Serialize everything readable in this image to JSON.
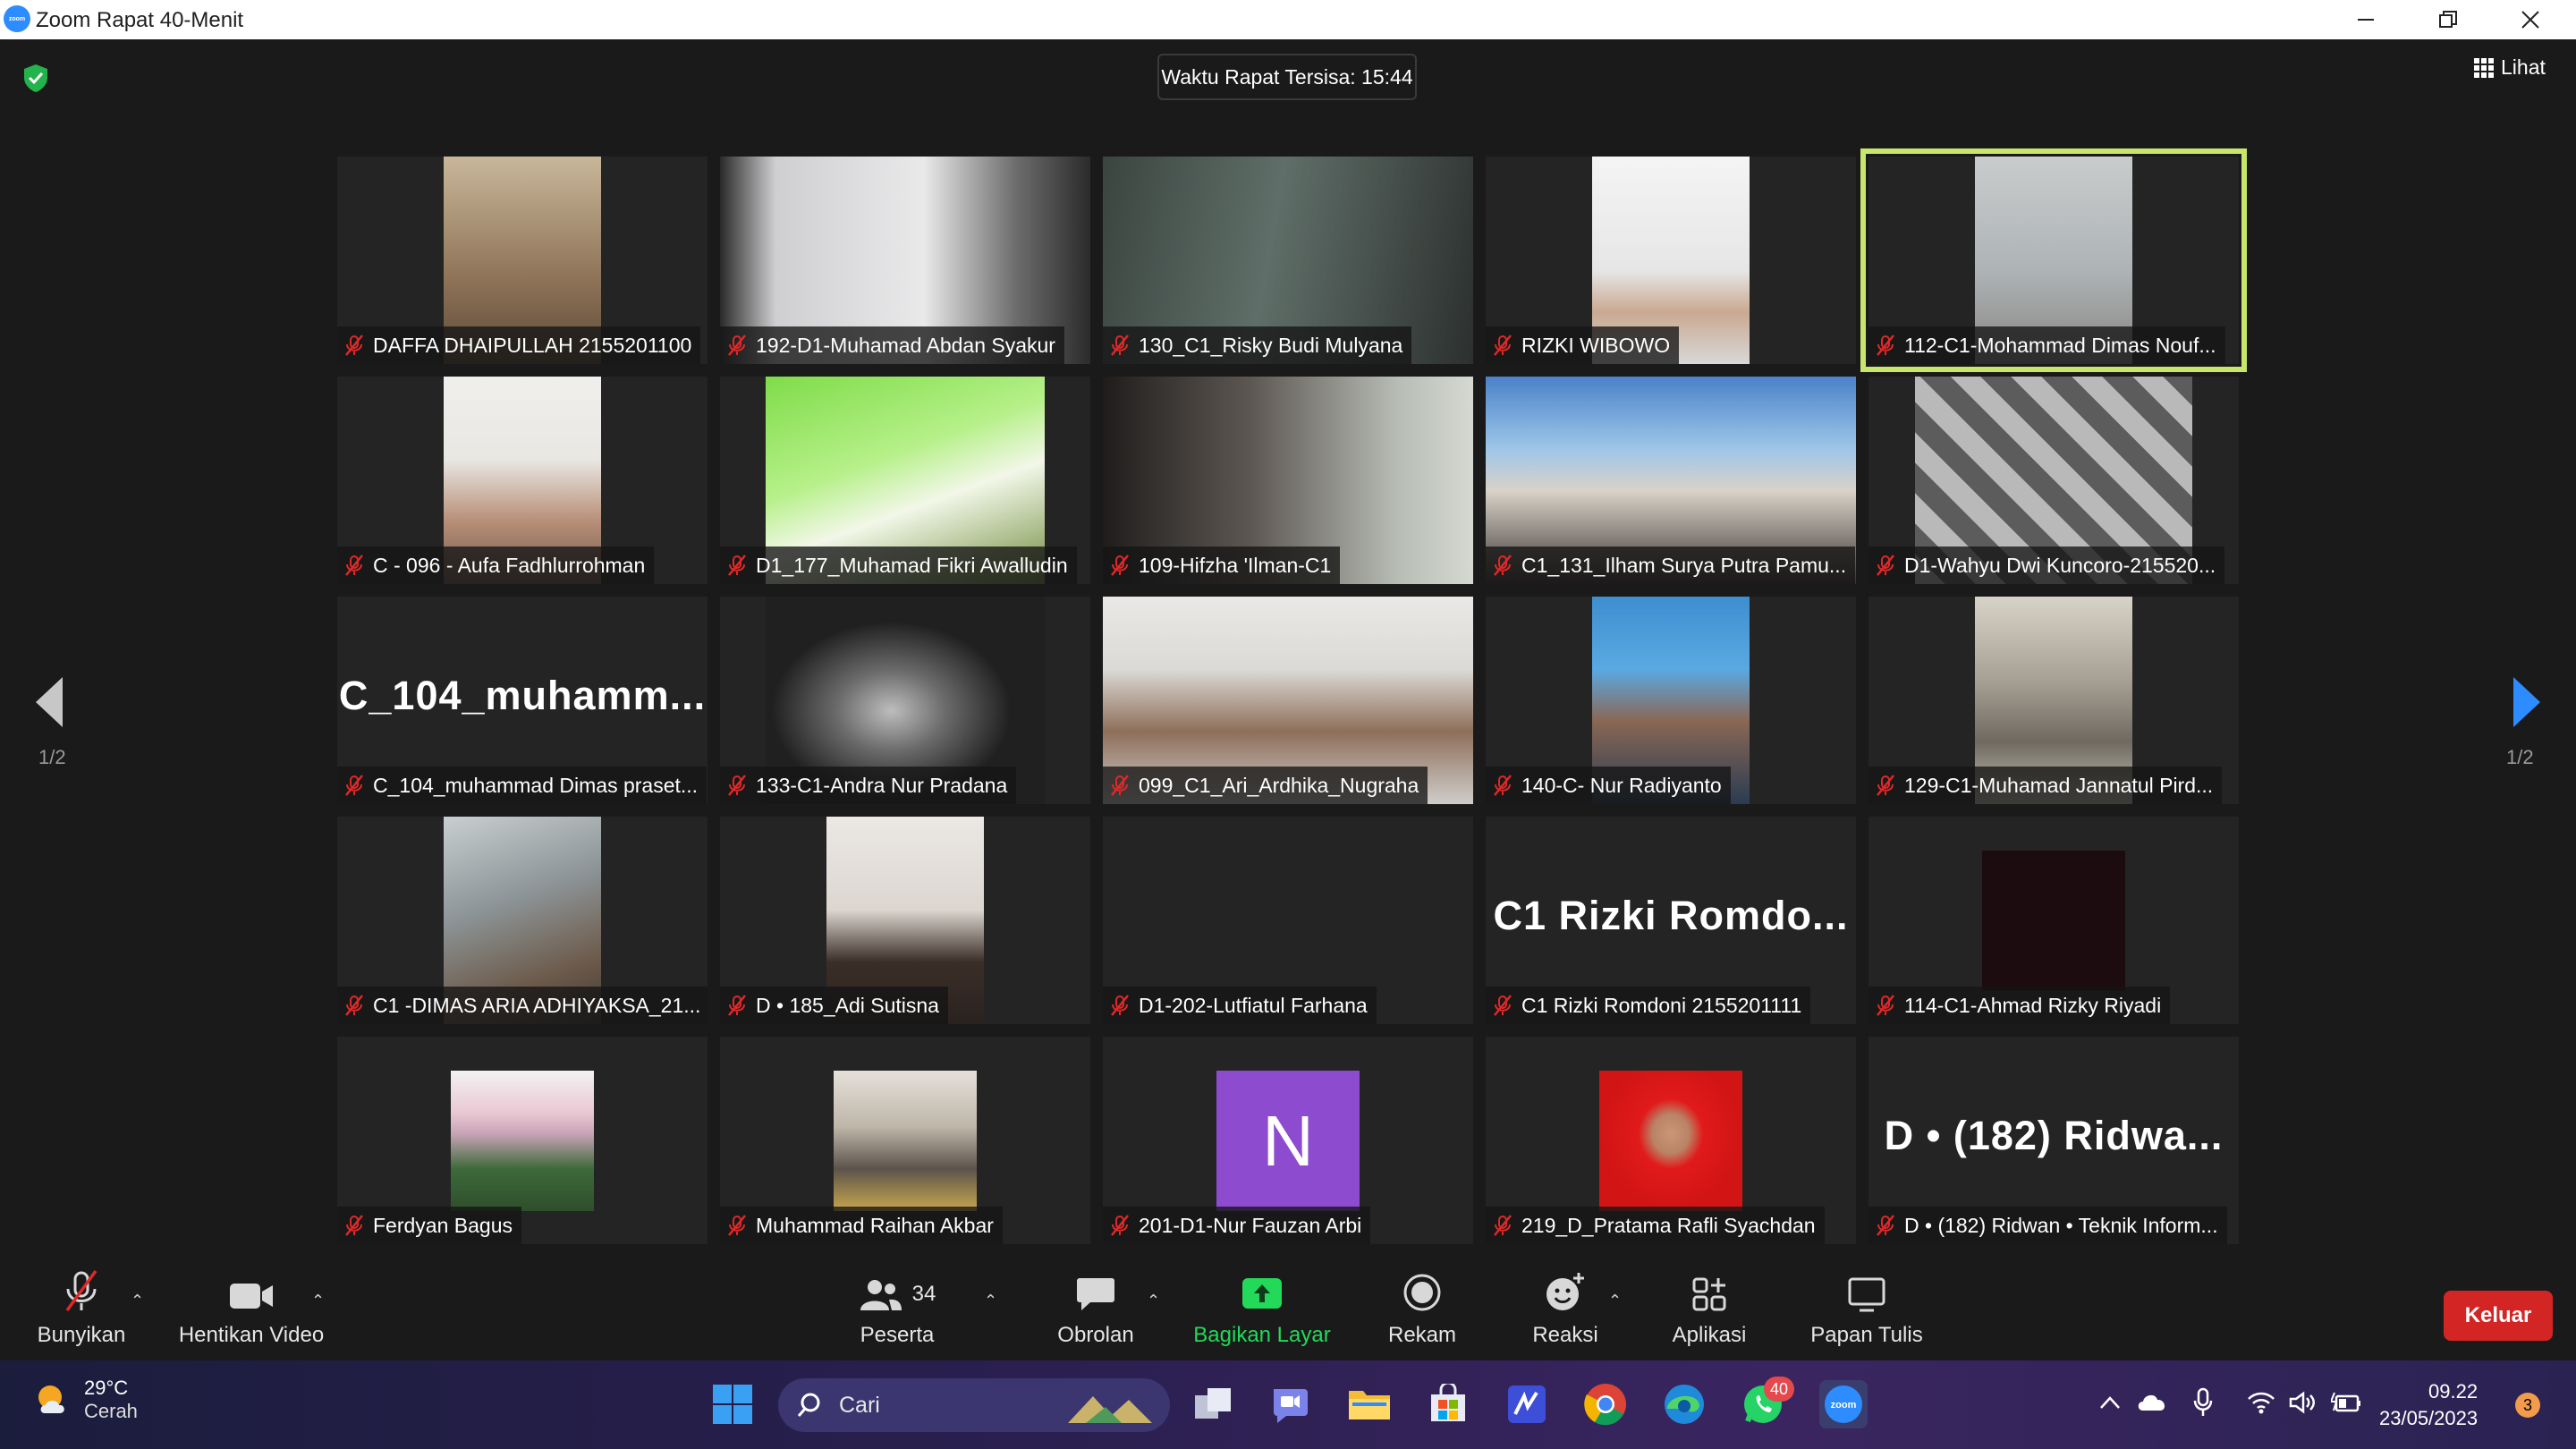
{
  "window": {
    "title": "Zoom Rapat 40-Menit",
    "minimize_icon": "minimize-icon",
    "restore_icon": "restore-icon",
    "close_icon": "close-icon"
  },
  "meeting": {
    "timer": "Waktu Rapat Tersisa: 15:44",
    "view_label": "Lihat",
    "page_left": "1/2",
    "page_right": "1/2"
  },
  "participants": [
    {
      "name": "DAFFA DHAIPULLAH 2155201100",
      "muted": true
    },
    {
      "name": "192-D1-Muhamad Abdan Syakur",
      "muted": true
    },
    {
      "name": "130_C1_Risky Budi Mulyana",
      "muted": true
    },
    {
      "name": "RIZKI WIBOWO",
      "muted": true
    },
    {
      "name": "112-C1-Mohammad Dimas Nouf...",
      "muted": true,
      "active_speaker": true
    },
    {
      "name": "C - 096 - Aufa Fadhlurrohman",
      "muted": true
    },
    {
      "name": "D1_177_Muhamad Fikri Awalludin",
      "muted": true
    },
    {
      "name": "109-Hifzha 'Ilman-C1",
      "muted": true
    },
    {
      "name": "C1_131_Ilham Surya Putra Pamu...",
      "muted": true
    },
    {
      "name": "D1-Wahyu Dwi Kuncoro-215520...",
      "muted": true
    },
    {
      "name": "C_104_muhammad Dimas praset...",
      "muted": true,
      "display": "C_104_muhamm..."
    },
    {
      "name": "133-C1-Andra Nur Pradana",
      "muted": true
    },
    {
      "name": "099_C1_Ari_Ardhika_Nugraha",
      "muted": true
    },
    {
      "name": "140-C- Nur Radiyanto",
      "muted": true
    },
    {
      "name": "129-C1-Muhamad Jannatul Pird...",
      "muted": true
    },
    {
      "name": "C1 -DIMAS ARIA ADHIYAKSA_21...",
      "muted": true
    },
    {
      "name": "D • 185_Adi Sutisna",
      "muted": true
    },
    {
      "name": "D1-202-Lutfiatul Farhana",
      "muted": true
    },
    {
      "name": "C1 Rizki Romdoni 2155201111",
      "muted": true,
      "display": "C1 Rizki Romdo..."
    },
    {
      "name": "114-C1-Ahmad Rizky Riyadi",
      "muted": true
    },
    {
      "name": "Ferdyan Bagus",
      "muted": true
    },
    {
      "name": "Muhammad Raihan Akbar",
      "muted": true
    },
    {
      "name": "201-D1-Nur Fauzan Arbi",
      "muted": true,
      "initial": "N"
    },
    {
      "name": "219_D_Pratama Rafli Syachdan",
      "muted": true
    },
    {
      "name": "D • (182) Ridwan • Teknik Inform...",
      "muted": true,
      "display": "D • (182) Ridwa..."
    }
  ],
  "toolbar": {
    "unmute": "Bunyikan",
    "stop_video": "Hentikan Video",
    "participants": "Peserta",
    "participant_count": "34",
    "chat": "Obrolan",
    "share_screen": "Bagikan Layar",
    "record": "Rekam",
    "reactions": "Reaksi",
    "apps": "Aplikasi",
    "whiteboard": "Papan Tulis",
    "leave": "Keluar"
  },
  "taskbar": {
    "temperature": "29°C",
    "weather": "Cerah",
    "search_placeholder": "Cari",
    "whatsapp_badge": "40",
    "time": "09.22",
    "date": "23/05/2023",
    "notifications": "3"
  },
  "colors": {
    "zoom_blue": "#2d8cff",
    "active_speaker": "#c8e66b",
    "share_green": "#23d959",
    "leave_red": "#d42525",
    "muted_red": "#e02828",
    "initial_tile": "#8d4ccf"
  }
}
